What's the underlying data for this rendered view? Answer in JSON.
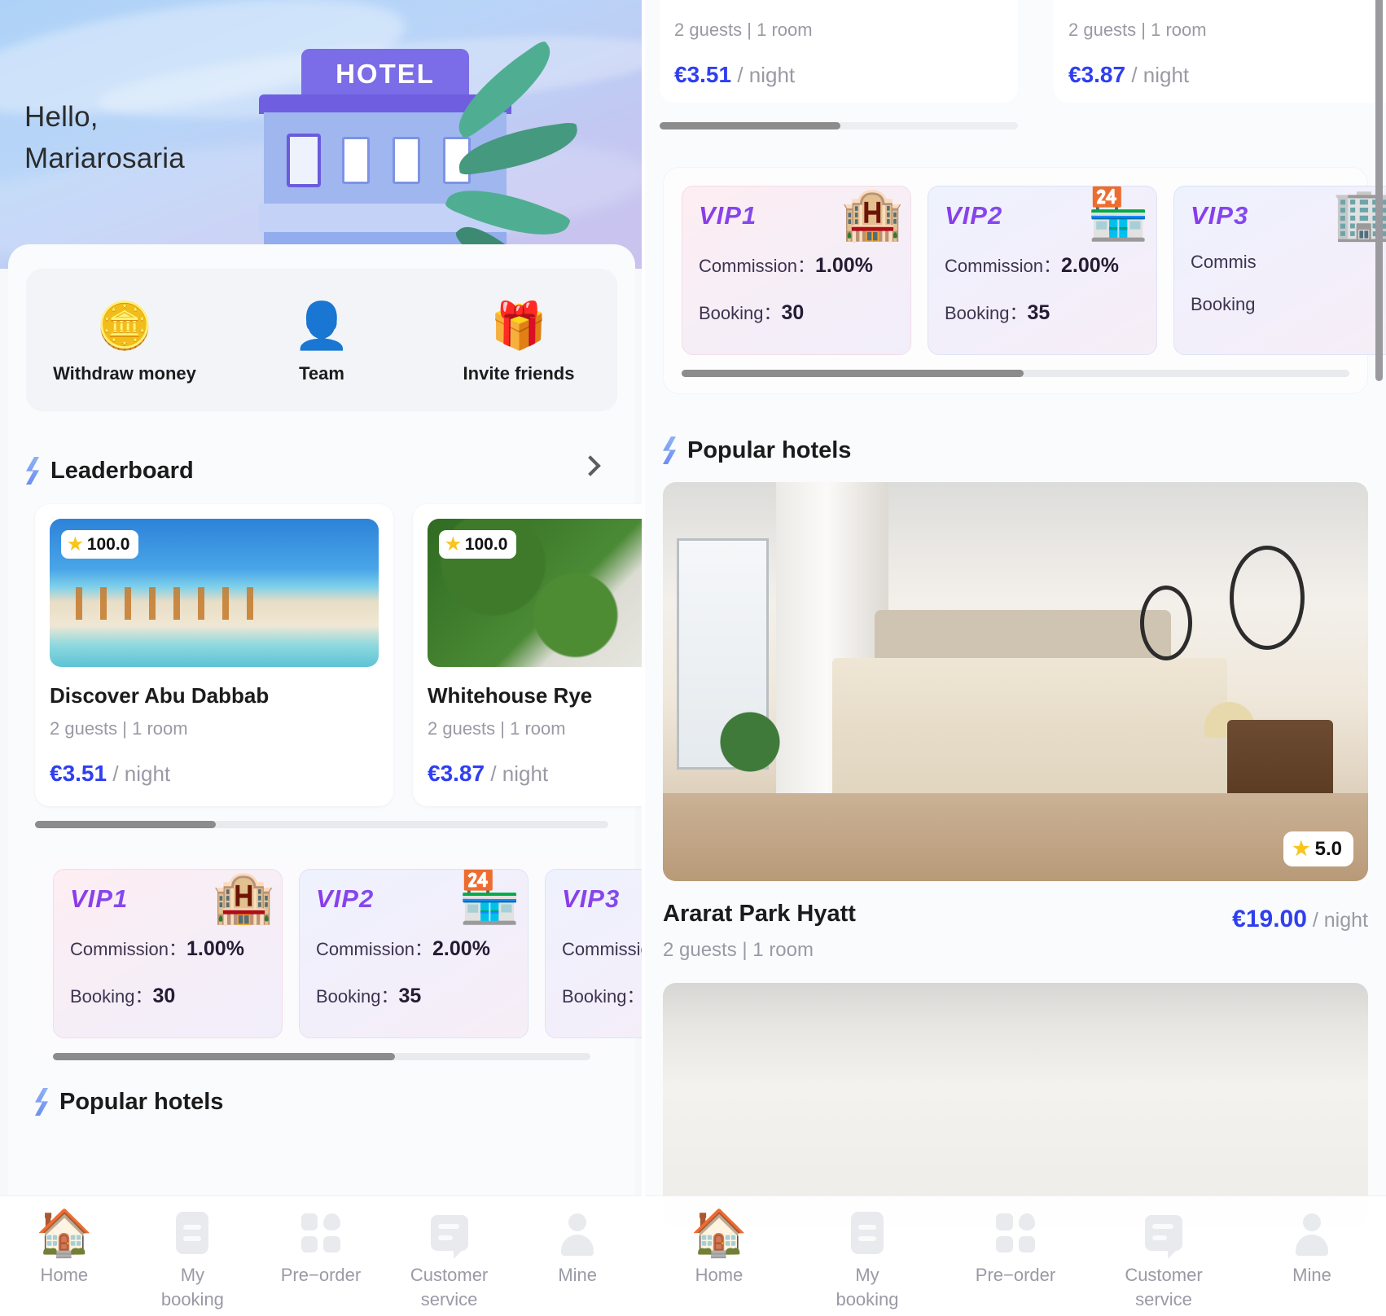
{
  "left": {
    "greeting_line1": "Hello,",
    "greeting_line2": "Mariarosaria",
    "hero_sign": "HOTEL",
    "quick_actions": [
      {
        "label": "Withdraw money",
        "icon": "coin-icon",
        "glyph": "🪙"
      },
      {
        "label": "Team",
        "icon": "team-icon",
        "glyph": "👤"
      },
      {
        "label": "Invite friends",
        "icon": "gift-icon",
        "glyph": "🎁"
      }
    ],
    "leaderboard": {
      "title": "Leaderboard",
      "chevron": "›",
      "cards": [
        {
          "rating": "100.0",
          "name": "Discover Abu Dabbab",
          "meta": "2 guests | 1 room",
          "price": "€3.51",
          "per": "/ night"
        },
        {
          "rating": "100.0",
          "name": "Whitehouse Rye",
          "meta": "2 guests | 1 room",
          "price": "€3.87",
          "per": "/ night"
        }
      ]
    },
    "vip": {
      "commission_label": "Commission：",
      "booking_label": "Booking：",
      "cards": [
        {
          "tier": "VIP1",
          "commission": "1.00%",
          "booking": "30",
          "glyph": "🏨"
        },
        {
          "tier": "VIP2",
          "commission": "2.00%",
          "booking": "35",
          "glyph": "🏪"
        },
        {
          "tier": "VIP3",
          "commission": "",
          "booking": "",
          "glyph": "🏢"
        }
      ]
    },
    "popular_title": "Popular hotels",
    "tabbar": [
      {
        "label": "Home",
        "icon": "house-icon",
        "active": true
      },
      {
        "label": "My\nbooking",
        "icon": "booking-icon",
        "active": false
      },
      {
        "label": "Pre−order",
        "icon": "grid-icon",
        "active": false
      },
      {
        "label": "Customer\nservice",
        "icon": "chat-icon",
        "active": false
      },
      {
        "label": "Mine",
        "icon": "user-icon",
        "active": false
      }
    ]
  },
  "right": {
    "top_cards": [
      {
        "meta": "2 guests | 1 room",
        "price": "€3.51",
        "per": "/ night"
      },
      {
        "meta": "2 guests | 1 room",
        "price": "€3.87",
        "per": "/ night"
      }
    ],
    "vip": {
      "commission_label": "Commission：",
      "booking_label": "Booking：",
      "cards": [
        {
          "tier": "VIP1",
          "commission": "1.00%",
          "booking": "30",
          "glyph": "🏨"
        },
        {
          "tier": "VIP2",
          "commission": "2.00%",
          "booking": "35",
          "glyph": "🏪"
        },
        {
          "tier": "VIP3",
          "commission_partial": "Commis",
          "booking_partial": "Booking",
          "glyph": "🏢"
        }
      ]
    },
    "popular_title": "Popular hotels",
    "hotel": {
      "rating": "5.0",
      "name": "Ararat Park Hyatt",
      "meta": "2 guests | 1 room",
      "price": "€19.00",
      "per": "/ night"
    },
    "tabbar": [
      {
        "label": "Home",
        "icon": "house-icon",
        "active": true
      },
      {
        "label": "My\nbooking",
        "icon": "booking-icon",
        "active": false
      },
      {
        "label": "Pre−order",
        "icon": "grid-icon",
        "active": false
      },
      {
        "label": "Customer\nservice",
        "icon": "chat-icon",
        "active": false
      },
      {
        "label": "Mine",
        "icon": "user-icon",
        "active": false
      }
    ]
  },
  "colors": {
    "price_blue": "#2f3ff0",
    "star_gold": "#f8c51c",
    "vip_purple": "#8b3bea",
    "muted_gray": "#9a9aa5"
  }
}
